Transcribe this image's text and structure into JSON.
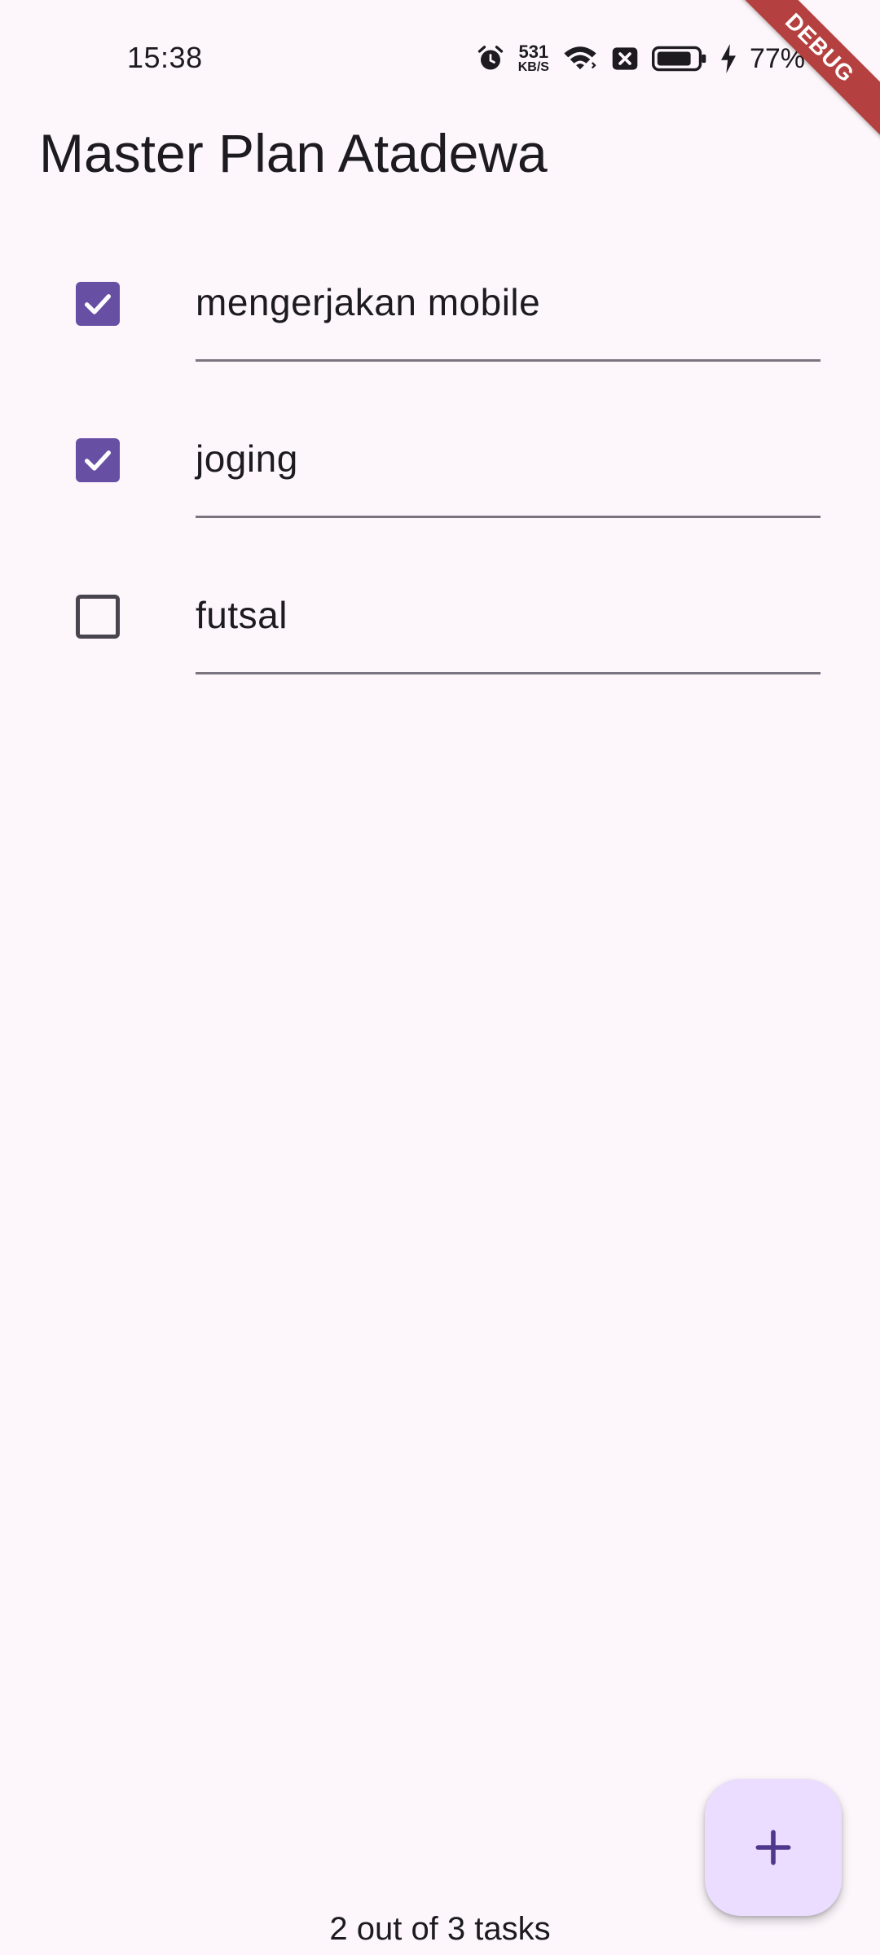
{
  "status_bar": {
    "time": "15:38",
    "net_speed_value": "531",
    "net_speed_unit": "KB/S",
    "battery_percent": "77%",
    "icons": [
      "alarm-icon",
      "wifi-icon",
      "sim-off-icon",
      "battery-icon",
      "charging-icon"
    ]
  },
  "debug_banner": "DEBUG",
  "app_bar": {
    "title": "Master Plan Atadewa"
  },
  "tasks": [
    {
      "text": "mengerjakan mobile",
      "completed": true
    },
    {
      "text": "joging",
      "completed": true
    },
    {
      "text": "futsal",
      "completed": false
    }
  ],
  "fab": {
    "icon": "plus-icon"
  },
  "footer": {
    "task_count_text": "2 out of 3 tasks"
  },
  "colors": {
    "background": "#fdf7fc",
    "checkbox_checked": "#6750a4",
    "fab_background": "#eaddff",
    "fab_icon": "#4f378b",
    "debug_ribbon": "#b4413f"
  }
}
